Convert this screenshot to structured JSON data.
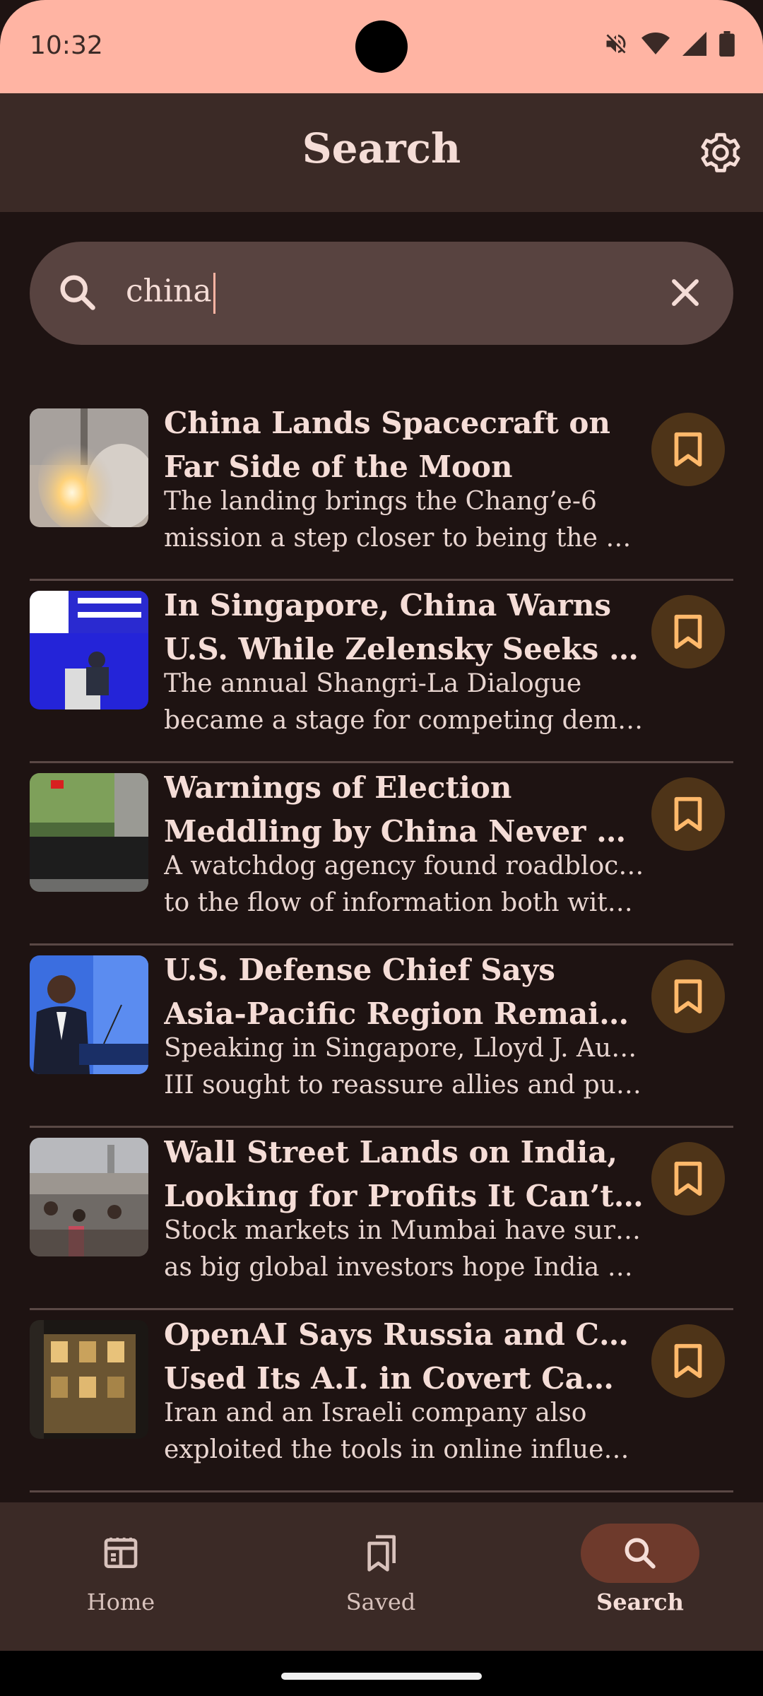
{
  "status_bar": {
    "time": "10:32"
  },
  "top_bar": {
    "title": "Search"
  },
  "search": {
    "value": "china"
  },
  "results": [
    {
      "title_lines": [
        "China Lands Spacecraft on",
        "Far Side of the Moon"
      ],
      "desc_lines": [
        "The landing brings the Chang’e-6",
        "mission a step closer to being the fir…"
      ]
    },
    {
      "title_lines": [
        "In Singapore, China Warns",
        "U.S. While Zelensky Seeks S…"
      ],
      "desc_lines": [
        "The annual Shangri-La Dialogue",
        "became a stage for competing dema…"
      ]
    },
    {
      "title_lines": [
        "Warnings of Election",
        "Meddling by China Never Re…"
      ],
      "desc_lines": [
        "A watchdog agency found roadblocks",
        "to the flow of information both with…"
      ]
    },
    {
      "title_lines": [
        "U.S. Defense Chief Says",
        "Asia-Pacific Region Remains…"
      ],
      "desc_lines": [
        "Speaking in Singapore, Lloyd J. Austin",
        "III sought to reassure allies and put …"
      ]
    },
    {
      "title_lines": [
        "Wall Street Lands on India,",
        "Looking for Profits It Can’t …"
      ],
      "desc_lines": [
        "Stock markets in Mumbai have surged",
        "as big global investors hope India ca…"
      ]
    },
    {
      "title_lines": [
        "OpenAI Says Russia and China",
        "Used Its A.I. in Covert Camp…"
      ],
      "desc_lines": [
        "Iran and an Israeli company also",
        "exploited the tools in online influenc…"
      ]
    }
  ],
  "bottom_nav": {
    "home": "Home",
    "saved": "Saved",
    "search": "Search"
  },
  "colors": {
    "status_bar": "#ffb4a3",
    "background": "#1e1312",
    "surface": "#3b2a26",
    "bookmark_bg": "#4e3418",
    "bookmark_icon": "#ffb96b",
    "active_nav": "#6e3a2c"
  }
}
